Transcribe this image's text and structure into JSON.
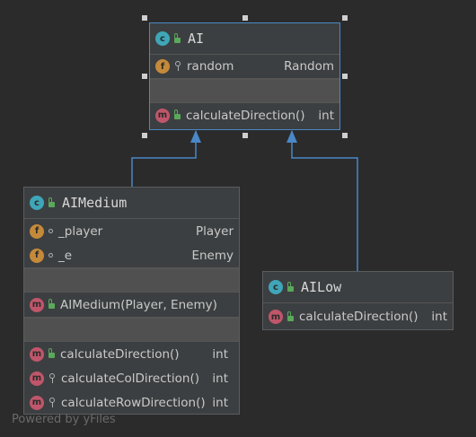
{
  "diagram": {
    "classes": {
      "ai": {
        "badge": "c",
        "name": "AI",
        "fields": [
          {
            "badge": "f",
            "visibility": "private",
            "name": "random",
            "type": "Random"
          }
        ],
        "methods": [
          {
            "badge": "m",
            "visibility": "public",
            "name": "calculateDirection()",
            "type": "int"
          }
        ]
      },
      "ai_medium": {
        "badge": "c",
        "name": "AIMedium",
        "fields": [
          {
            "badge": "f",
            "visibility": "package",
            "name": "_player",
            "type": "Player"
          },
          {
            "badge": "f",
            "visibility": "package",
            "name": "_e",
            "type": "Enemy"
          }
        ],
        "constructors": [
          {
            "badge": "m",
            "visibility": "public",
            "name": "AIMedium(Player, Enemy)"
          }
        ],
        "methods": [
          {
            "badge": "m",
            "visibility": "public",
            "name": "calculateDirection()",
            "type": "int"
          },
          {
            "badge": "m",
            "visibility": "private",
            "name": "calculateColDirection()",
            "type": "int"
          },
          {
            "badge": "m",
            "visibility": "private",
            "name": "calculateRowDirection()",
            "type": "int"
          }
        ]
      },
      "ai_low": {
        "badge": "c",
        "name": "AILow",
        "methods": [
          {
            "badge": "m",
            "visibility": "public",
            "name": "calculateDirection()",
            "type": "int"
          }
        ]
      }
    },
    "colors": {
      "background": "#2b2b2b",
      "box": "#3c3f41",
      "edge": "#4a88c7",
      "selection": "#4a88c7"
    },
    "watermark": "Powered by yFiles"
  }
}
